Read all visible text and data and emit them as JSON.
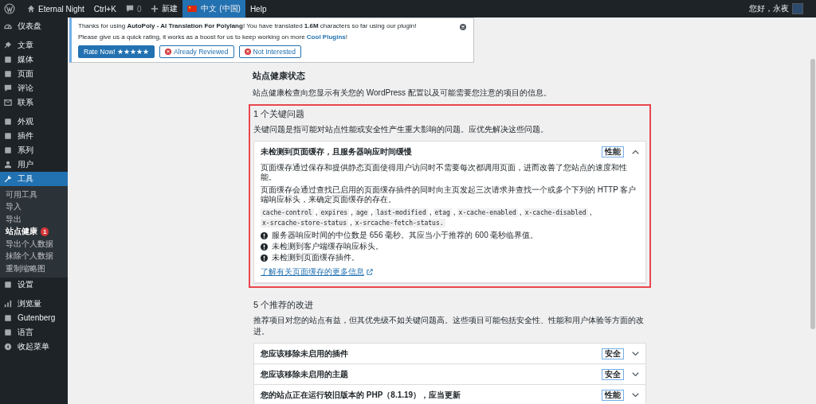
{
  "admin_bar": {
    "items": [
      {
        "kind": "logo"
      },
      {
        "kind": "site",
        "label": "Eternal Night"
      },
      {
        "kind": "text",
        "label": "Ctrl+K"
      },
      {
        "kind": "comments",
        "label": "0"
      },
      {
        "kind": "new",
        "label": "新建"
      },
      {
        "kind": "language",
        "label": "中文 (中国)",
        "selected": true
      },
      {
        "kind": "text",
        "label": "Help"
      }
    ],
    "greeting": "您好，永夜"
  },
  "sidebar": {
    "sections": [
      [
        {
          "label": "仪表盘",
          "selected": false
        }
      ],
      [
        {
          "label": "文章",
          "selected": false
        },
        {
          "label": "媒体",
          "selected": false
        },
        {
          "label": "页面",
          "selected": false
        },
        {
          "label": "评论",
          "selected": false
        },
        {
          "label": "联系",
          "selected": false
        }
      ],
      [
        {
          "label": "外观",
          "selected": false
        },
        {
          "label": "插件",
          "selected": false
        },
        {
          "label": "系列",
          "selected": false
        },
        {
          "label": "用户",
          "selected": false
        },
        {
          "label": "工具",
          "selected": true,
          "children": [
            {
              "label": "可用工具",
              "selected": false
            },
            {
              "label": "导入",
              "selected": false
            },
            {
              "label": "导出",
              "selected": false
            },
            {
              "label": "站点健康",
              "selected": true,
              "badge": "1"
            },
            {
              "label": "导出个人数据",
              "selected": false
            },
            {
              "label": "抹除个人数据",
              "selected": false
            },
            {
              "label": "重制缩略图",
              "selected": false
            }
          ]
        },
        {
          "label": "设置",
          "selected": false
        }
      ],
      [
        {
          "label": "浏览量",
          "selected": false
        },
        {
          "label": "Gutenberg",
          "selected": false
        },
        {
          "label": "语言",
          "selected": false
        },
        {
          "label": "收起菜单",
          "selected": false
        }
      ]
    ]
  },
  "notice": {
    "line1": "Thanks for using **AutoPoly - AI Translation For Polylang**! You have translated **1.6M** characters so far using our plugin!",
    "line2_before": "Please give us a quick rating, it works as a boost for us to keep working on more",
    "line2_link": "Cool Plugins",
    "line2_after": "!",
    "buttons": [
      {
        "kind": "primary",
        "label": "Rate Now! ★★★★★"
      },
      {
        "kind": "dismiss",
        "label": "Already Reviewed"
      },
      {
        "kind": "dismiss",
        "label": "Not Interested"
      }
    ]
  },
  "page": {
    "title": "站点健康状态",
    "description": "站点健康检查向您显示有关您的 WordPress 配置以及可能需要您注意的项目的信息。",
    "sections": [
      {
        "heading": "1 个关键问题",
        "highlighted": true,
        "description": "关键问题是指可能对站点性能或安全性产生重大影响的问题。应优先解决这些问题。",
        "issues": [
          {
            "title": "未检测到页面缓存，且服务器响应时间缓慢",
            "badge": "性能",
            "expanded": true,
            "paragraphs": [
              "页面缓存通过保存和提供静态页面使得用户访问时不需要每次都调用页面，进而改善了您站点的速度和性能。",
              "页面缓存会通过查找已启用的页面缓存插件的同时向主页发起三次请求并查找一个或多个下列的 HTTP 客户端响应标头，来确定页面缓存的存在。"
            ],
            "codes": [
              "cache-control",
              "expires",
              "age",
              "last-modified",
              "etag",
              "x-cache-enabled",
              "x-cache-disabled",
              "x-srcache-store-status",
              "x-srcache-fetch-status."
            ],
            "code_separator": ",",
            "notes": [
              "服务器响应时间的中位数是 656 毫秒。其应当小于推荐的 600 毫秒临界值。",
              "未检测到客户端缓存响应标头。",
              "未检测到页面缓存插件。"
            ],
            "link": "了解有关页面缓存的更多信息"
          }
        ]
      },
      {
        "heading": "5 个推荐的改进",
        "highlighted": false,
        "description": "推荐项目对您的站点有益，但其优先级不如关键问题高。这些项目可能包括安全性、性能和用户体验等方面的改进。",
        "issues": [
          {
            "title": "您应该移除未启用的插件",
            "badge": "安全",
            "expanded": false
          },
          {
            "title": "您应该移除未启用的主题",
            "badge": "安全",
            "expanded": false
          },
          {
            "title": "您的站点正在运行较旧版本的 PHP（8.1.19），应当更新",
            "badge": "性能",
            "expanded": false
          }
        ]
      }
    ]
  }
}
